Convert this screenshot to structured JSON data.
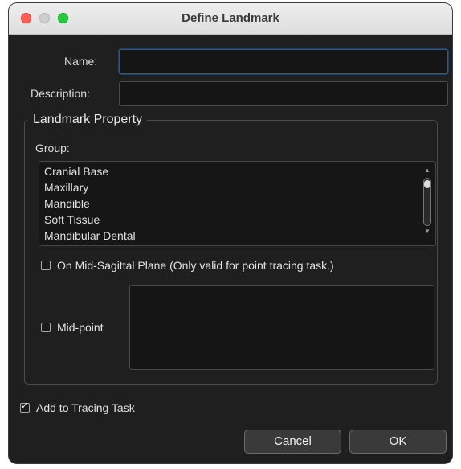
{
  "window": {
    "title": "Define Landmark"
  },
  "form": {
    "name_label": "Name:",
    "name_value": "",
    "description_label": "Description:",
    "description_value": ""
  },
  "landmark_property": {
    "title": "Landmark Property",
    "group_label": "Group:",
    "group_items": [
      "Cranial Base",
      "Maxillary",
      "Mandible",
      "Soft Tissue",
      "Mandibular Dental"
    ],
    "mid_sagittal_label": "On Mid-Sagittal Plane (Only valid for point tracing task.)",
    "mid_sagittal_checked": false,
    "midpoint_label": "Mid-point",
    "midpoint_checked": false
  },
  "add_to_tracing": {
    "label": "Add to Tracing Task",
    "checked": true
  },
  "buttons": {
    "cancel": "Cancel",
    "ok": "OK"
  },
  "colors": {
    "window_bg": "#1f1f1f",
    "close": "#ff5f57",
    "zoom": "#28c840",
    "focus": "#2c5a86"
  }
}
